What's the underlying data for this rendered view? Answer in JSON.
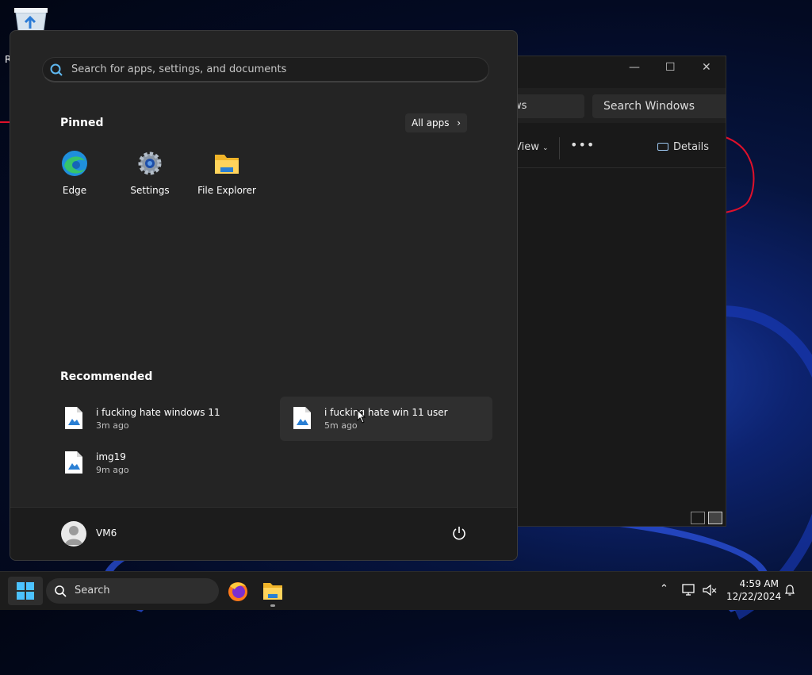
{
  "desktop": {
    "recycle_bin_label": "R"
  },
  "explorer": {
    "address_fragment": "ws",
    "search_placeholder": "Search Windows",
    "view_label": "View",
    "more_label": "•••",
    "details_label": "Details",
    "minimize": "—",
    "maximize": "☐",
    "close": "✕"
  },
  "start_menu": {
    "search_placeholder": "Search for apps, settings, and documents",
    "pinned_heading": "Pinned",
    "all_apps_label": "All apps",
    "pinned_apps": [
      {
        "label": "Edge",
        "icon": "edge-icon"
      },
      {
        "label": "Settings",
        "icon": "settings-gear-icon"
      },
      {
        "label": "File Explorer",
        "icon": "folder-icon"
      }
    ],
    "recommended_heading": "Recommended",
    "recommended": [
      {
        "name": "i fucking hate windows 11",
        "time": "3m ago",
        "icon": "image-file-icon"
      },
      {
        "name": "i fucking hate win 11 user",
        "time": "5m ago",
        "icon": "image-file-icon"
      },
      {
        "name": "img19",
        "time": "9m ago",
        "icon": "image-file-icon"
      }
    ],
    "user_name": "VM6"
  },
  "taskbar": {
    "search_label": "Search",
    "time": "4:59 AM",
    "date": "12/22/2024",
    "apps": [
      "firefox-icon",
      "file-explorer-icon"
    ]
  },
  "colors": {
    "accent": "#0078d4",
    "menu_bg": "#242424",
    "taskbar_bg": "#1c1c1c",
    "scribble": "#e0102a"
  }
}
